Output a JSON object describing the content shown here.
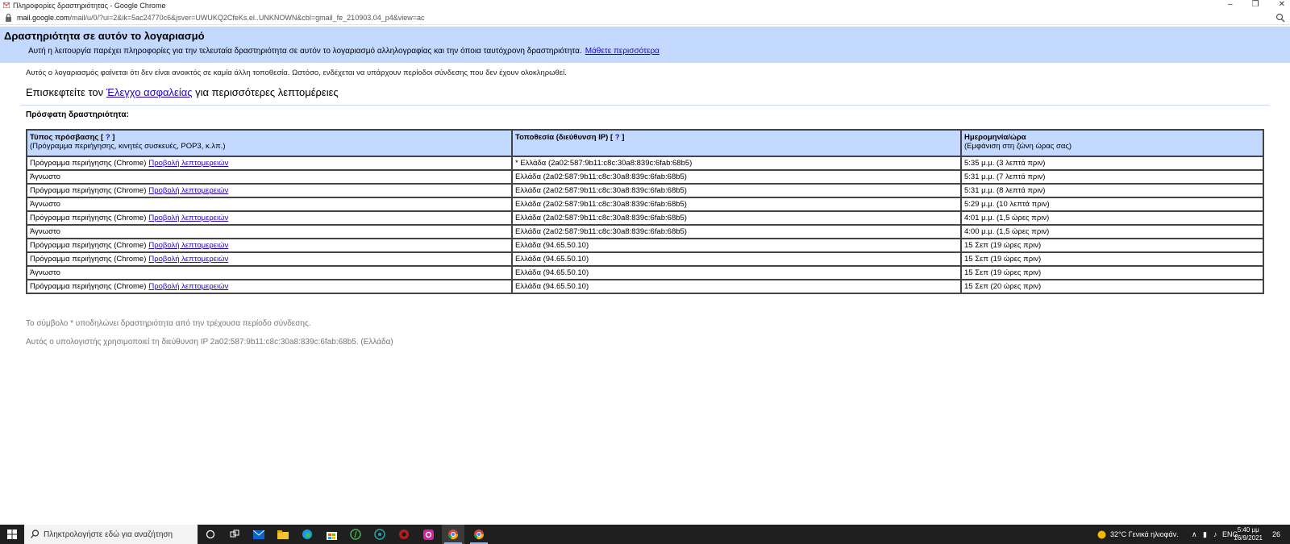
{
  "window": {
    "title": "Πληροφορίες δραστηριότητας - Google Chrome",
    "buttons": [
      "–",
      "❐",
      "✕"
    ]
  },
  "address": {
    "domain": "mail.google.com",
    "path": "/mail/u/0/?ui=2&ik=5ac24770c6&jsver=UWUKQ2CfeKs.el..UNKNOWN&cbl=gmail_fe_210903.04_p4&view=ac"
  },
  "banner": {
    "title": "Δραστηριότητα σε αυτόν το λογαριασμό",
    "description": "Αυτή η λειτουργία παρέχει πληροφορίες για την τελευταία δραστηριότητα σε αυτόν το λογαριασμό αλληλογραφίας και την όποια ταυτόχρονη δραστηριότητα.",
    "learn_more": "Μάθετε περισσότερα"
  },
  "message": "Αυτός ο λογαριασμός φαίνεται ότι δεν είναι ανοικτός σε καμία άλλη τοποθεσία. Ωστόσο, ενδέχεται να υπάρχουν περίοδοι σύνδεσης που δεν έχουν ολοκληρωθεί.",
  "visit": {
    "prefix": "Επισκεφτείτε τον",
    "link": "Έλεγχο ασφαλείας",
    "suffix": "για περισσότερες λεπτομέρειες"
  },
  "recent_label": "Πρόσφατη δραστηριότητα:",
  "table": {
    "headers": [
      {
        "title": "Τύπος πρόσβασης",
        "help": "?",
        "sub": "(Πρόγραμμα περιήγησης, κινητές συσκευές, POP3, κ.λπ.)"
      },
      {
        "title": "Τοποθεσία (διεύθυνση IP)",
        "help": "?",
        "sub": ""
      },
      {
        "title": "Ημερομηνία/ώρα",
        "help": "",
        "sub": "(Εμφάνιση στη ζώνη ώρας σας)"
      }
    ],
    "details_link": "Προβολή λεπτομερειών",
    "rows": [
      {
        "access": "Πρόγραμμα περιήγησης (Chrome)",
        "details": true,
        "location": "* Ελλάδα (2a02:587:9b11:c8c:30a8:839c:6fab:68b5)",
        "date": "5:35 μ.μ. (3 λεπτά πριν)"
      },
      {
        "access": "Άγνωστο",
        "details": false,
        "location": "Ελλάδα (2a02:587:9b11:c8c:30a8:839c:6fab:68b5)",
        "date": "5:31 μ.μ. (7 λεπτά πριν)"
      },
      {
        "access": "Πρόγραμμα περιήγησης (Chrome)",
        "details": true,
        "location": "Ελλάδα (2a02:587:9b11:c8c:30a8:839c:6fab:68b5)",
        "date": "5:31 μ.μ. (8 λεπτά πριν)"
      },
      {
        "access": "Άγνωστο",
        "details": false,
        "location": "Ελλάδα (2a02:587:9b11:c8c:30a8:839c:6fab:68b5)",
        "date": "5:29 μ.μ. (10 λεπτά πριν)"
      },
      {
        "access": "Πρόγραμμα περιήγησης (Chrome)",
        "details": true,
        "location": "Ελλάδα (2a02:587:9b11:c8c:30a8:839c:6fab:68b5)",
        "date": "4:01 μ.μ. (1,5 ώρες πριν)"
      },
      {
        "access": "Άγνωστο",
        "details": false,
        "location": "Ελλάδα (2a02:587:9b11:c8c:30a8:839c:6fab:68b5)",
        "date": "4:00 μ.μ. (1,5 ώρες πριν)"
      },
      {
        "access": "Πρόγραμμα περιήγησης (Chrome)",
        "details": true,
        "location": "Ελλάδα (94.65.50.10)",
        "date": "15 Σεπ (19 ώρες πριν)"
      },
      {
        "access": "Πρόγραμμα περιήγησης (Chrome)",
        "details": true,
        "location": "Ελλάδα (94.65.50.10)",
        "date": "15 Σεπ (19 ώρες πριν)"
      },
      {
        "access": "Άγνωστο",
        "details": false,
        "location": "Ελλάδα (94.65.50.10)",
        "date": "15 Σεπ (19 ώρες πριν)"
      },
      {
        "access": "Πρόγραμμα περιήγησης (Chrome)",
        "details": true,
        "location": "Ελλάδα (94.65.50.10)",
        "date": "15 Σεπ (20 ώρες πριν)"
      }
    ]
  },
  "footnote": "Το σύμβολο * υποδηλώνει δραστηριότητα από την τρέχουσα περίοδο σύνδεσης.",
  "ip_note": "Αυτός ο υπολογιστής χρησιμοποιεί τη διεύθυνση IP 2a02:587:9b11:c8c:30a8:839c:6fab:68b5. (Ελλάδα)",
  "taskbar": {
    "search_placeholder": "Πληκτρολογήστε εδώ για αναζήτηση",
    "weather": "32°C  Γενικά ηλιοφάν.",
    "language": "ENG",
    "time": "5:40 μμ",
    "date": "16/9/2021",
    "notifications": "26"
  }
}
